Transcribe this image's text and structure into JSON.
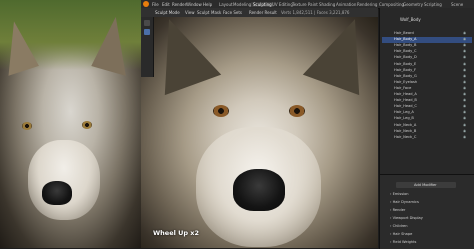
{
  "topbar": {
    "menus": [
      "File",
      "Edit",
      "Render",
      "Window",
      "Help"
    ],
    "tabs": [
      "Layout",
      "Modeling",
      "Sculpting",
      "UV Editing",
      "Texture Paint",
      "Shading",
      "Animation",
      "Rendering",
      "Compositing",
      "Geometry",
      "Scripting"
    ],
    "active_tab": "Sculpting",
    "scene_label": "Scene"
  },
  "header2": {
    "mode": "Sculpt Mode",
    "items": [
      "View",
      "Sculpt",
      "Mask",
      "Face Sets"
    ],
    "render_label": "Render Result",
    "stats": "Verts 1,842,511 | Faces 3,221,876"
  },
  "viewport": {
    "overlay_text": "Wheel Up x2"
  },
  "outliner": {
    "title": "Wolf_Body",
    "items": [
      "Hair_Beard",
      "Hair_Body_A",
      "Hair_Body_B",
      "Hair_Body_C",
      "Hair_Body_D",
      "Hair_Body_E",
      "Hair_Body_F",
      "Hair_Body_G",
      "Hair_Eyelash",
      "Hair_Face",
      "Hair_Head_A",
      "Hair_Head_B",
      "Hair_Head_C",
      "Hair_Leg_A",
      "Hair_Leg_B",
      "Hair_Neck_A",
      "Hair_Neck_B",
      "Hair_Neck_C"
    ],
    "selected_index": 1
  },
  "properties": {
    "add_modifier": "Add Modifier",
    "sections": [
      "Emission",
      "Hair Dynamics",
      "Render",
      "Viewport Display",
      "Children",
      "Hair Shape",
      "Field Weights"
    ]
  },
  "colors": {
    "accent": "#4b6fa8",
    "selection": "#334d80",
    "panel": "#282828"
  }
}
